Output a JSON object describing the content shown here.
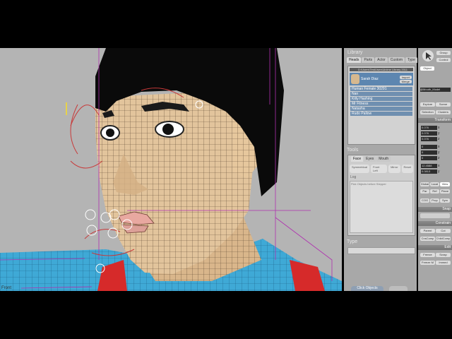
{
  "viewport": {
    "label": "Front"
  },
  "library": {
    "title": "Library",
    "tabs": [
      "Heads",
      "Parts",
      "Actor",
      "Custom",
      "Type"
    ],
    "path": "D:\\Users\\TestUsers\\Anime Library 2011",
    "selected_head": "Sarah Diaz",
    "buttons": [
      "Import",
      "Merge"
    ],
    "items": [
      "Human Female 30291",
      "Nan",
      "Kitty Hashing",
      "Mr Fitness",
      "Natasha",
      "Rudo Pallow"
    ]
  },
  "tools": {
    "title": "Tools",
    "tabs": [
      "Face",
      "Eyes",
      "Mouth"
    ],
    "buttons": [
      "Symmetrical",
      "Front Left",
      "Mirror",
      "Reset"
    ],
    "log_label": "Log",
    "log_text": "Pick Objects before Stepper"
  },
  "type": {
    "title": "Type"
  },
  "click_label": "Click Objects",
  "right": {
    "top_buttons": [
      "Group",
      "Control"
    ],
    "object_label": "Object",
    "object_name": "@Mouth_Model",
    "select_buttons": [
      "Explore",
      "Scene",
      "Selection",
      "Clusters"
    ],
    "transform_title": "Transform",
    "transform_values": [
      "0.076",
      "0.076",
      "0.076",
      "0",
      "0",
      "0",
      "12.4588",
      "0.0813"
    ],
    "axes": [
      "x",
      "y",
      "z",
      "x",
      "y",
      "z",
      "x",
      "y"
    ],
    "view_buttons": [
      "Global",
      "Local",
      "View",
      "Par",
      "Ref",
      "Plane",
      "COG",
      "Prop",
      "Sym"
    ],
    "snap_title": "Snap",
    "constrain_title": "Constrain",
    "constrain_buttons": [
      "Parent",
      "Cut",
      "CnsComp",
      "ChildComp"
    ],
    "edit_title": "Edit",
    "edit_buttons": [
      "Freeze",
      "Scrap",
      "Freeze M",
      "Immed"
    ]
  },
  "colors": {
    "viewport_bg": "#b4b4b4",
    "skin": "#e2c49c",
    "hair": "#0a0a0a",
    "shirt": "#3fa9d6",
    "strap": "#d62a2a",
    "accent": "#5d86b0"
  }
}
